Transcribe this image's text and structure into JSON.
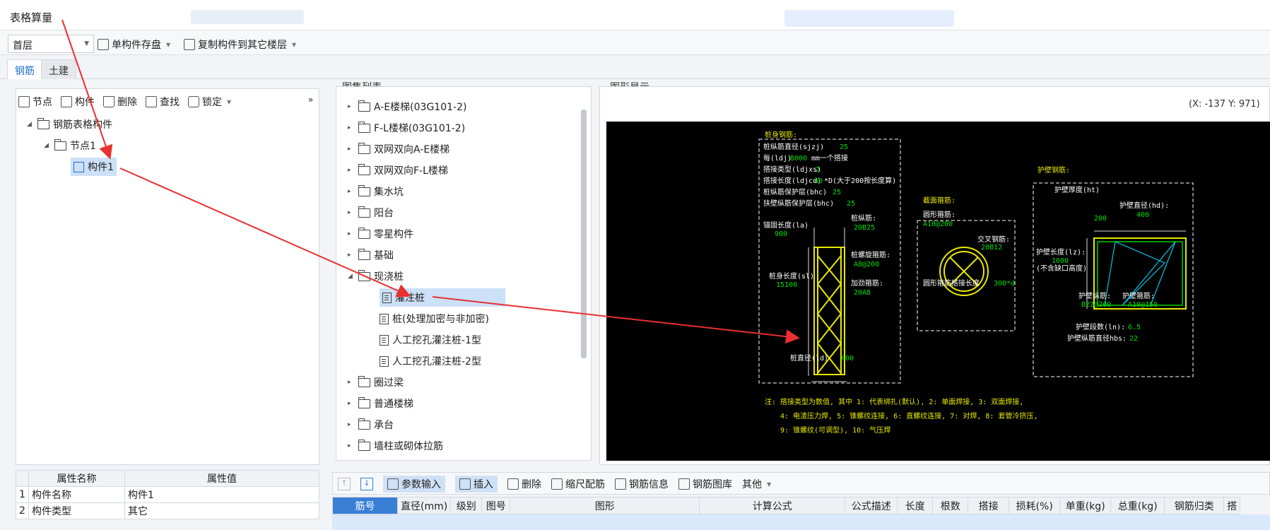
{
  "window": {
    "title": "表格算量"
  },
  "toolbar": {
    "floor": "首层",
    "save_single": "单构件存盘",
    "copy_to_floor": "复制构件到其它楼层"
  },
  "tabs": [
    {
      "label": "钢筋"
    },
    {
      "label": "土建"
    }
  ],
  "left_toolbar": {
    "node": "节点",
    "component": "构件",
    "delete": "删除",
    "find": "查找",
    "lock": "锁定",
    "more": "»"
  },
  "tree": {
    "root": "钢筋表格构件",
    "node": "节点1",
    "component": "构件1"
  },
  "props": {
    "col_name": "属性名称",
    "col_value": "属性值",
    "rows": [
      {
        "idx": "1",
        "name": "构件名称",
        "value": "构件1"
      },
      {
        "idx": "2",
        "name": "构件类型",
        "value": "其它"
      }
    ]
  },
  "atlas": {
    "title": "图集列表",
    "items": [
      {
        "label": "A-E楼梯(03G101-2)"
      },
      {
        "label": "F-L楼梯(03G101-2)"
      },
      {
        "label": "双网双向A-E楼梯"
      },
      {
        "label": "双网双向F-L楼梯"
      },
      {
        "label": "集水坑"
      },
      {
        "label": "阳台"
      },
      {
        "label": "零星构件"
      },
      {
        "label": "基础"
      },
      {
        "label": "现浇桩"
      }
    ],
    "children": [
      {
        "label": "灌注桩"
      },
      {
        "label": "桩(处理加密与非加密)"
      },
      {
        "label": "人工挖孔灌注桩-1型"
      },
      {
        "label": "人工挖孔灌注桩-2型"
      }
    ],
    "items_after": [
      {
        "label": "圈过梁"
      },
      {
        "label": "普通楼梯"
      },
      {
        "label": "承台"
      },
      {
        "label": "墙柱或砌体拉筋"
      }
    ]
  },
  "graphic": {
    "title": "图形显示",
    "coord": "(X: -137 Y: 971)",
    "body": {
      "title": "桩身钢筋:",
      "lines": [
        "桩纵筋直径(sjzj)",
        "每(ldj)",
        "mm一个搭接",
        "搭接类型(ldjxs)",
        "搭接长度(ldjcd)",
        "*D(大于200按长度算)",
        "桩纵筋保护层(bhc)",
        "扶壁纵筋保护层(bhc)"
      ],
      "values": [
        "25",
        "8000",
        "2",
        "40",
        "25",
        "25"
      ],
      "anchor_label": "锚固长度(la)",
      "anchor_value": "900",
      "length_label": "桩身长度(sl)",
      "length_value": "15100",
      "long_bar_label": "桩纵筋:",
      "long_bar_value": "20B25",
      "spiral_label": "桩螺旋箍筋:",
      "spiral_value": "A8@200",
      "stiff_label": "加劲箍筋:",
      "stiff_value": "20A8",
      "diameter_label": "桩直径(ld)",
      "diameter_value": "400"
    },
    "section": {
      "title": "截面箍筋:",
      "ring_label": "圆形箍筋:",
      "ring_value": "A10@200",
      "cross_label": "交叉钢筋:",
      "cross_value": "20B12",
      "lap_label": "圆形箍筋搭接长度",
      "lap_value": "300*d"
    },
    "guard": {
      "title": "护壁钢筋:",
      "thick_label": "护壁厚度(ht)",
      "thick_value": "200",
      "dia_label": "护壁直径(hd):",
      "dia_value": "400",
      "len_label": "护壁长度(lz):",
      "len_value": "1600",
      "len_note": "(不含缺口高度)",
      "long_label": "护壁纵筋:",
      "long_value": "B22@200",
      "hoop_label": "护壁箍筋:",
      "hoop_value": "A10@150",
      "seg_label": "护壁段数(ln):",
      "seg_value": "6.5",
      "seg_dia_label": "护壁纵筋直径hbs:",
      "seg_dia_value": "22"
    },
    "notes": [
      "注: 搭接类型为数值, 其中 1: 代表绑扎(默认), 2: 单面焊接, 3: 双面焊接,",
      "4: 电渣压力焊, 5: 锥螺纹连接, 6: 直螺纹连接, 7: 对焊, 8: 套管冷挤压,",
      "9: 锥螺纹(可调型), 10: 气压焊"
    ]
  },
  "bottom_toolbar": {
    "param_input": "参数输入",
    "insert": "插入",
    "delete": "删除",
    "scale_bar": "缩尺配筋",
    "info": "钢筋信息",
    "library": "钢筋图库",
    "other": "其他"
  },
  "steel_table": {
    "headers": [
      "筋号",
      "直径(mm)",
      "级别",
      "图号",
      "图形",
      "计算公式",
      "公式描述",
      "长度",
      "根数",
      "搭接",
      "损耗(%)",
      "单重(kg)",
      "总重(kg)",
      "钢筋归类",
      "搭"
    ]
  }
}
